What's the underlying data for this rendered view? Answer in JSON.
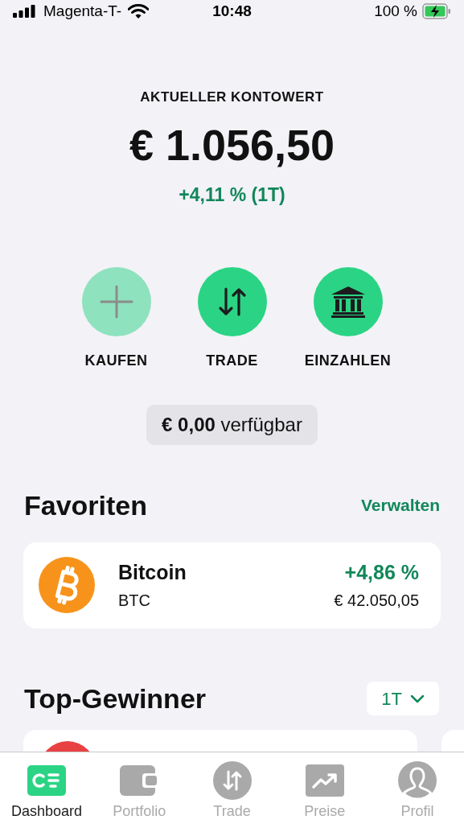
{
  "status_bar": {
    "carrier": "Magenta-T-",
    "time": "10:48",
    "battery": "100 %"
  },
  "account": {
    "label": "AKTUELLER KONTOWERT",
    "value": "€ 1.056,50",
    "change": "+4,11 % (1T)"
  },
  "actions": [
    {
      "label": "KAUFEN",
      "kind": "plus",
      "disabled": true
    },
    {
      "label": "TRADE",
      "kind": "trade",
      "disabled": false
    },
    {
      "label": "EINZAHLEN",
      "kind": "bank",
      "disabled": false
    }
  ],
  "available": "**€ 0,00** verfügbar",
  "favorites": {
    "title": "Favoriten",
    "action": "Verwalten",
    "items": [
      {
        "name": "Bitcoin",
        "symbol": "BTC",
        "change": "+4,86 %",
        "price": "€ 42.050,05"
      }
    ]
  },
  "top_gainers": {
    "title": "Top-Gewinner",
    "period": "1T"
  },
  "tab_bar": [
    {
      "label": "Dashboard",
      "kind": "dashboard",
      "selected": true
    },
    {
      "label": "Portfolio",
      "kind": "wallet",
      "selected": false
    },
    {
      "label": "Trade",
      "kind": "trade",
      "selected": false
    },
    {
      "label": "Preise",
      "kind": "chart",
      "selected": false
    },
    {
      "label": "Profil",
      "kind": "profile",
      "selected": false
    }
  ]
}
